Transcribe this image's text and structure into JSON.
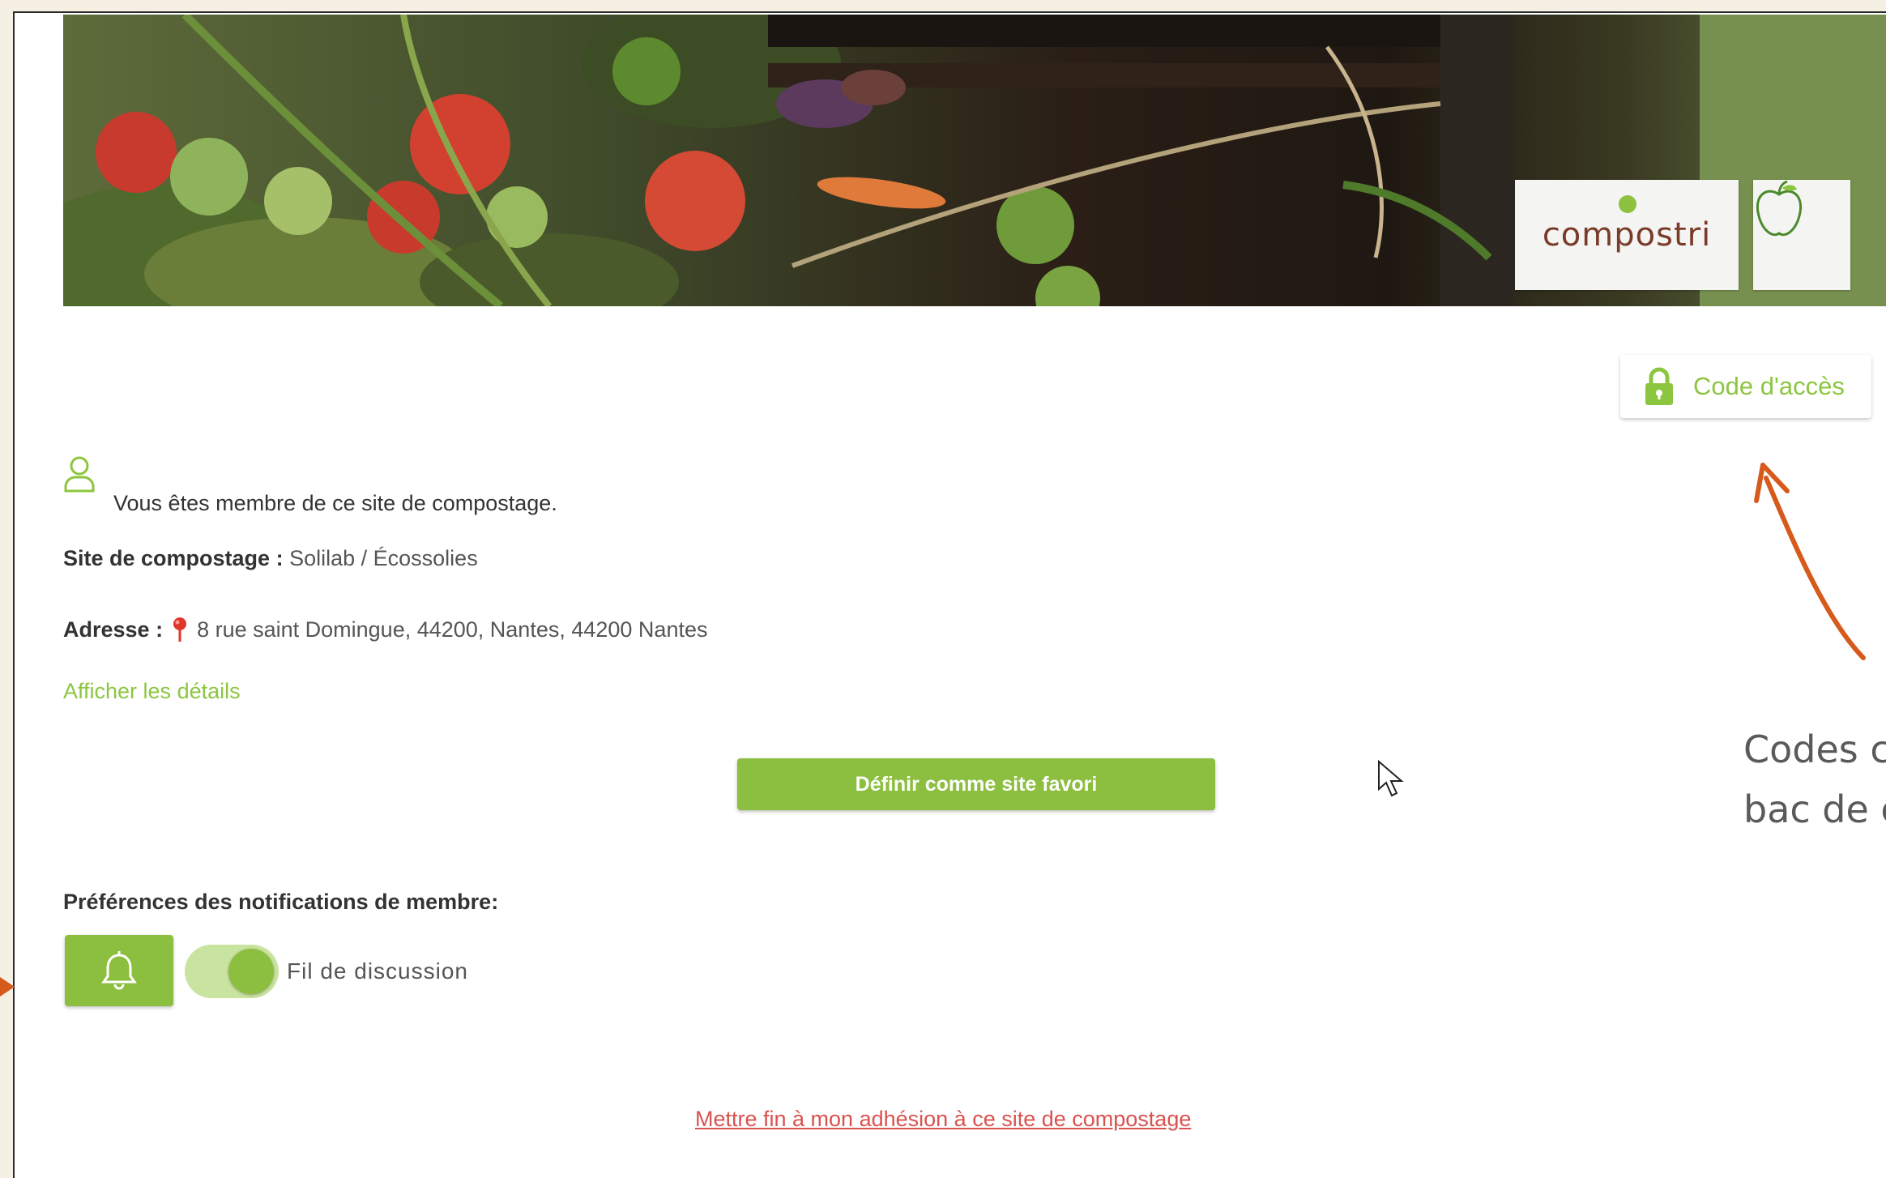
{
  "banner": {
    "logo_text": "compostri",
    "logo_icon": "apple-icon"
  },
  "access_code": {
    "label": "Code d'accès",
    "icon": "lock-icon"
  },
  "membership": {
    "icon": "user-icon",
    "message": "Vous êtes membre de ce site de compostage.",
    "site_label": "Site de compostage :",
    "site_value": "Solilab / Écossolies",
    "address_label": "Adresse :",
    "address_icon": "map-pin-icon",
    "address_value": "8 rue saint Domingue, 44200, Nantes, 44200 Nantes",
    "details_link": "Afficher les détails"
  },
  "favorite_button": "Définir comme site favori",
  "notifications": {
    "title": "Préférences des notifications de membre:",
    "bell_icon": "bell-icon",
    "toggle_on": true,
    "toggle_label": "Fil de discussion"
  },
  "leave_link": "Mettre fin à mon adhésion à ce site de compostage",
  "annotation": {
    "line1": "Codes c",
    "line2": "bac de c"
  },
  "colors": {
    "accent_green": "#8cbf3f",
    "link_green": "#8cc63f",
    "danger_red": "#d9524f",
    "arrow_orange": "#d65a1c"
  }
}
